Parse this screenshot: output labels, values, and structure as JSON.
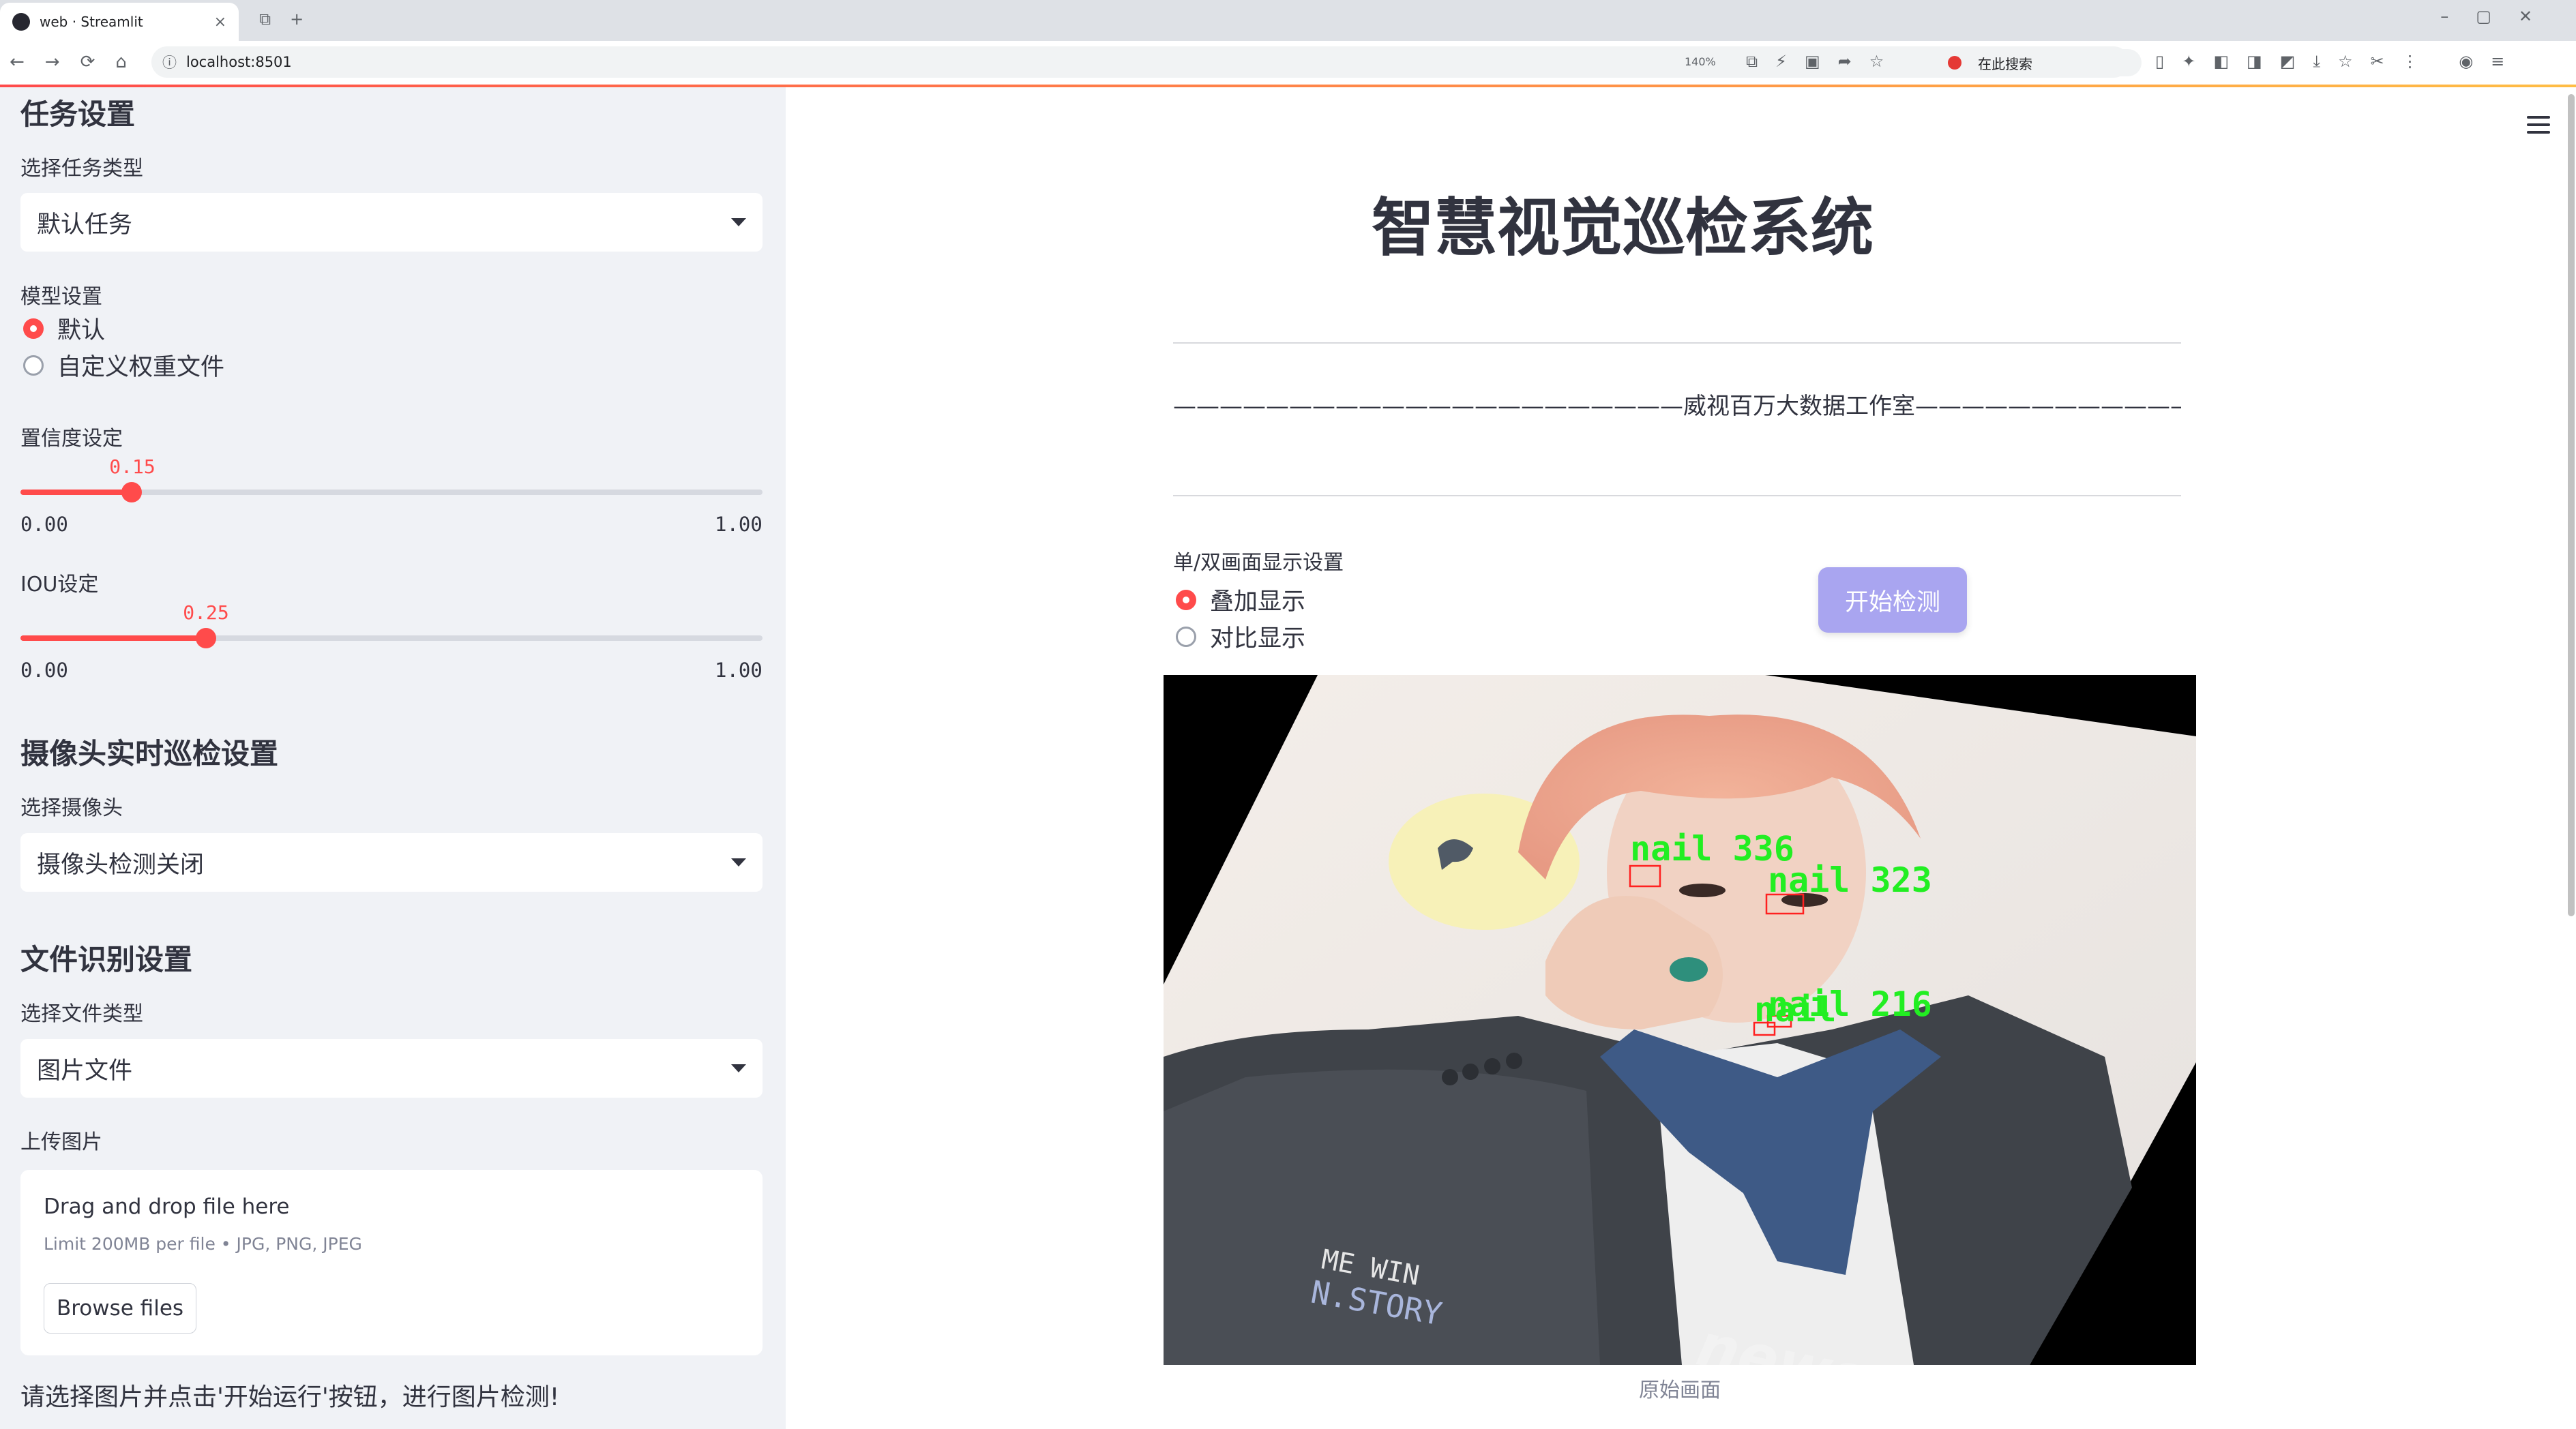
{
  "browser": {
    "tab_title": "web · Streamlit",
    "tab_close": "×",
    "url": "localhost:8501",
    "zoom": "140%",
    "search_placeholder": "在此搜索"
  },
  "sidebar": {
    "task_section": "任务设置",
    "task_type_label": "选择任务类型",
    "task_type_value": "默认任务",
    "model_label": "模型设置",
    "model_options": [
      "默认",
      "自定义权重文件"
    ],
    "model_selected": "默认",
    "conf_label": "置信度设定",
    "conf_value": "0.15",
    "conf_min": "0.00",
    "conf_max": "1.00",
    "iou_label": "IOU设定",
    "iou_value": "0.25",
    "iou_min": "0.00",
    "iou_max": "1.00",
    "camera_section": "摄像头实时巡检设置",
    "camera_label": "选择摄像头",
    "camera_value": "摄像头检测关闭",
    "file_section": "文件识别设置",
    "file_type_label": "选择文件类型",
    "file_type_value": "图片文件",
    "upload_label": "上传图片",
    "upload_drag": "Drag and drop file here",
    "upload_limit": "Limit 200MB per file • JPG, PNG, JPEG",
    "upload_button": "Browse files",
    "hint": "请选择图片并点击'开始运行'按钮，进行图片检测!"
  },
  "main": {
    "title": "智慧视觉巡检系统",
    "studio_line": "——————————————————————威视百万大数据工作室———————————————————————",
    "display_label": "单/双画面显示设置",
    "display_options": [
      "叠加显示",
      "对比显示"
    ],
    "display_selected": "叠加显示",
    "start_button": "开始检测",
    "caption": "原始画面",
    "detections": [
      {
        "label": "nail 336"
      },
      {
        "label": "nail 323"
      },
      {
        "label": "nail 216"
      },
      {
        "label": "nail"
      }
    ],
    "shirt_text": [
      "ME WIN",
      "N.STORY"
    ],
    "logo_text": "news"
  },
  "colors": {
    "accent": "#ff4b4b",
    "sidebar_bg": "#f0f2f6",
    "button": "#a9a5f0",
    "detection_box": "#ff2020",
    "detection_text": "#22ee22"
  }
}
